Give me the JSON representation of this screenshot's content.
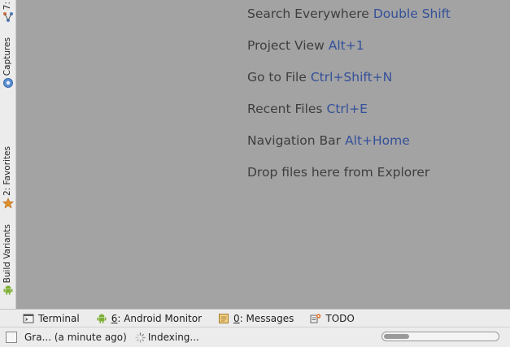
{
  "left_tabs": [
    {
      "label": "7:",
      "icon": "structure-icon"
    },
    {
      "label": "Captures",
      "icon": "captures-icon"
    },
    {
      "label": "2: Favorites",
      "icon": "star-icon"
    },
    {
      "label": "Build Variants",
      "icon": "android-icon"
    }
  ],
  "hints": [
    {
      "text": "Search Everywhere",
      "key": "Double Shift"
    },
    {
      "text": "Project View",
      "key": "Alt+1"
    },
    {
      "text": "Go to File",
      "key": "Ctrl+Shift+N"
    },
    {
      "text": "Recent Files",
      "key": "Ctrl+E"
    },
    {
      "text": "Navigation Bar",
      "key": "Alt+Home"
    },
    {
      "text": "Drop files here from Explorer",
      "key": ""
    }
  ],
  "tool_tabs": {
    "terminal": {
      "label": "Terminal"
    },
    "android_monitor": {
      "mnemonic": "6",
      "rest": ": Android Monitor"
    },
    "messages": {
      "mnemonic": "0",
      "rest": ": Messages"
    },
    "todo": {
      "label": "TODO"
    }
  },
  "status": {
    "message": "Gra... (a minute ago)",
    "indexing": "Indexing...",
    "progress": 0.22
  },
  "colors": {
    "editor_bg": "#a3a3a3",
    "hint_text": "#3e3e3e",
    "hint_key": "#34509a",
    "panel_bg": "#ececec"
  }
}
